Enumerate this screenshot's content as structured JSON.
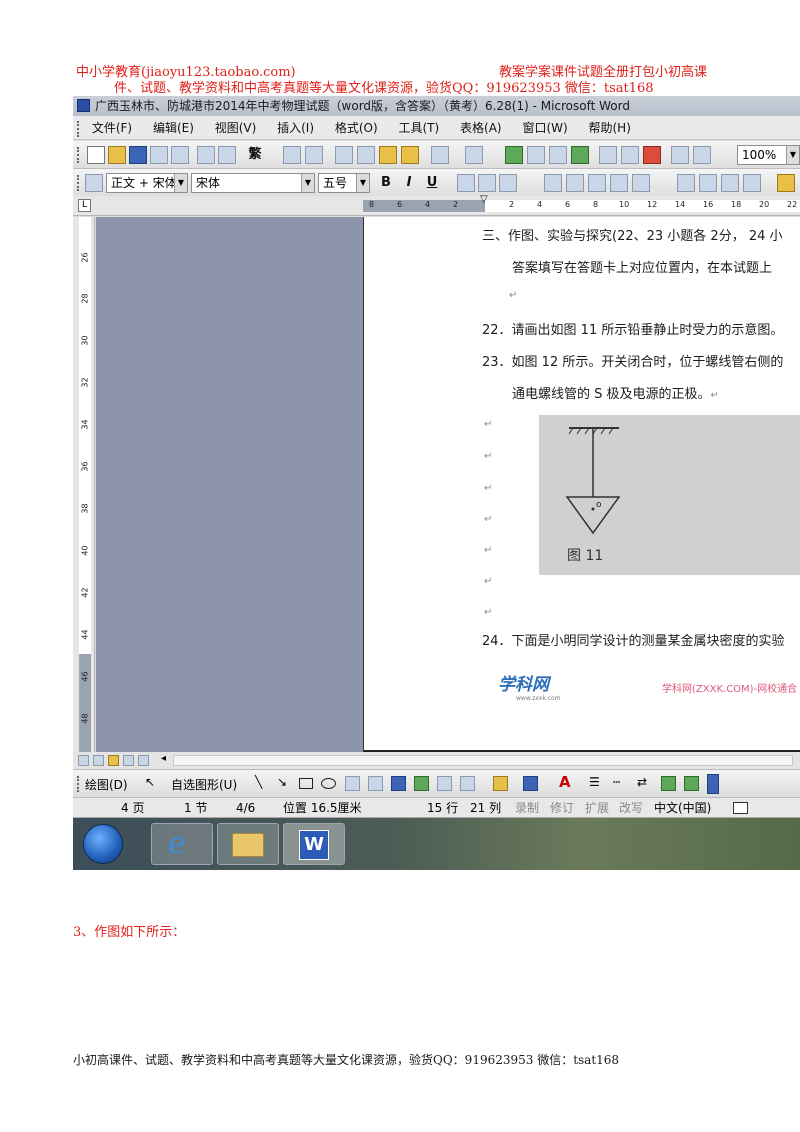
{
  "header": {
    "left": "中小学教育(jiaoyu123.taobao.com)",
    "right": "教案学案课件试题全册打包小初高课",
    "line2": "件、试题、教学资料和中高考真题等大量文化课资源，验货QQ：919623953      微信：tsat168"
  },
  "window": {
    "title": "广西玉林市、防城港市2014年中考物理试题（word版，含答案）（黄考）6.28(1) - Microsoft Word"
  },
  "menu": [
    "文件(F)",
    "编辑(E)",
    "视图(V)",
    "插入(I)",
    "格式(O)",
    "工具(T)",
    "表格(A)",
    "窗口(W)",
    "帮助(H)"
  ],
  "toolbar": {
    "traditional": "繁",
    "zoom": "100%"
  },
  "format_bar": {
    "style": "正文 + 宋体",
    "font": "宋体",
    "size": "五号",
    "bold": "B",
    "italic": "I",
    "underline": "U"
  },
  "ruler": {
    "h_ticks": [
      "8",
      "6",
      "4",
      "2",
      "2",
      "4",
      "6",
      "8",
      "10",
      "12",
      "14",
      "16",
      "18",
      "20",
      "22"
    ],
    "v_ticks": [
      "26",
      "28",
      "30",
      "32",
      "34",
      "36",
      "38",
      "40",
      "42",
      "44",
      "46",
      "48"
    ]
  },
  "document": {
    "line1": "三、作图、实验与探究(22、23 小题各 2分，  24 小",
    "line2": "答案填写在答题卡上对应位置内，在本试题上",
    "q22": "22．请画出如图 11 所示铅垂静止时受力的示意图。",
    "q23": "23．如图 12 所示。开关闭合时，位于螺线管右侧的",
    "q23b": "通电螺线管的 S 极及电源的正极。",
    "q24": "24．下面是小明同学设计的测量某金属块密度的实验",
    "paragraph_mark": "↵",
    "figure_label": "图 11",
    "figure_point": "o",
    "watermark_logo": "学科网",
    "watermark_url": "www.zxxk.com",
    "watermark_right": "学科网(ZXXK.COM)-网校通合"
  },
  "drawbar": {
    "draw": "绘图(D)",
    "autoshape": "自选图形(U)"
  },
  "status": {
    "page": "4 页",
    "section": "1 节",
    "pages": "4/6",
    "position": "位置 16.5厘米",
    "line": "15 行",
    "col": "21 列",
    "rec": "录制",
    "trk": "修订",
    "ext": "扩展",
    "ovr": "改写",
    "lang": "中文(中国)"
  },
  "answer": "3、作图如下所示：",
  "footer": "小初高课件、试题、教学资料和中高考真题等大量文化课资源，验货QQ：919623953     微信：tsat168"
}
